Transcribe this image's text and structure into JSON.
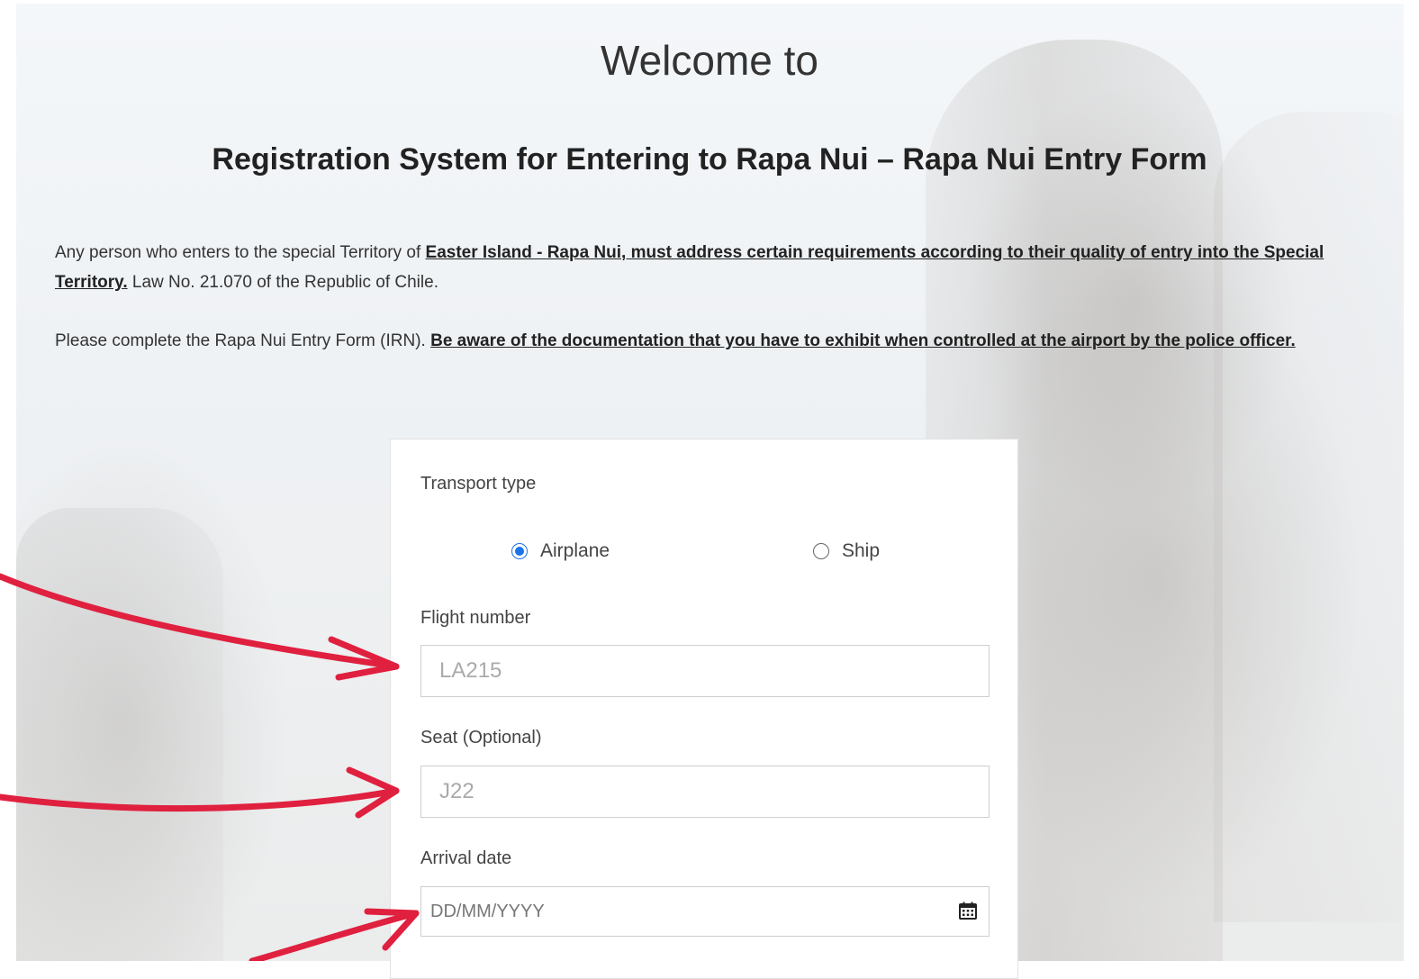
{
  "header": {
    "welcome": "Welcome to",
    "title": "Registration System for Entering to Rapa Nui – Rapa Nui Entry Form"
  },
  "intro": {
    "p1_a": "Any person who enters to the special Territory of ",
    "p1_bold": "Easter Island - Rapa Nui, must address certain requirements according to their quality of entry into the Special Territory.",
    "p1_b": " Law No. 21.070 of the Republic of Chile.",
    "p2_a": "Please complete the Rapa Nui Entry Form (IRN). ",
    "p2_bold": "Be aware of the documentation that you have to exhibit when controlled at the airport by the police officer."
  },
  "form": {
    "transport_label": "Transport type",
    "options": [
      {
        "label": "Airplane",
        "selected": true
      },
      {
        "label": "Ship",
        "selected": false
      }
    ],
    "flight_label": "Flight number",
    "flight_placeholder": "LA215",
    "seat_label": "Seat (Optional)",
    "seat_placeholder": "J22",
    "date_label": "Arrival date",
    "date_placeholder": "DD/MM/YYYY",
    "calendar_icon": "calendar-icon"
  },
  "colors": {
    "accent": "#1a73e8",
    "arrow": "#e0203f"
  }
}
